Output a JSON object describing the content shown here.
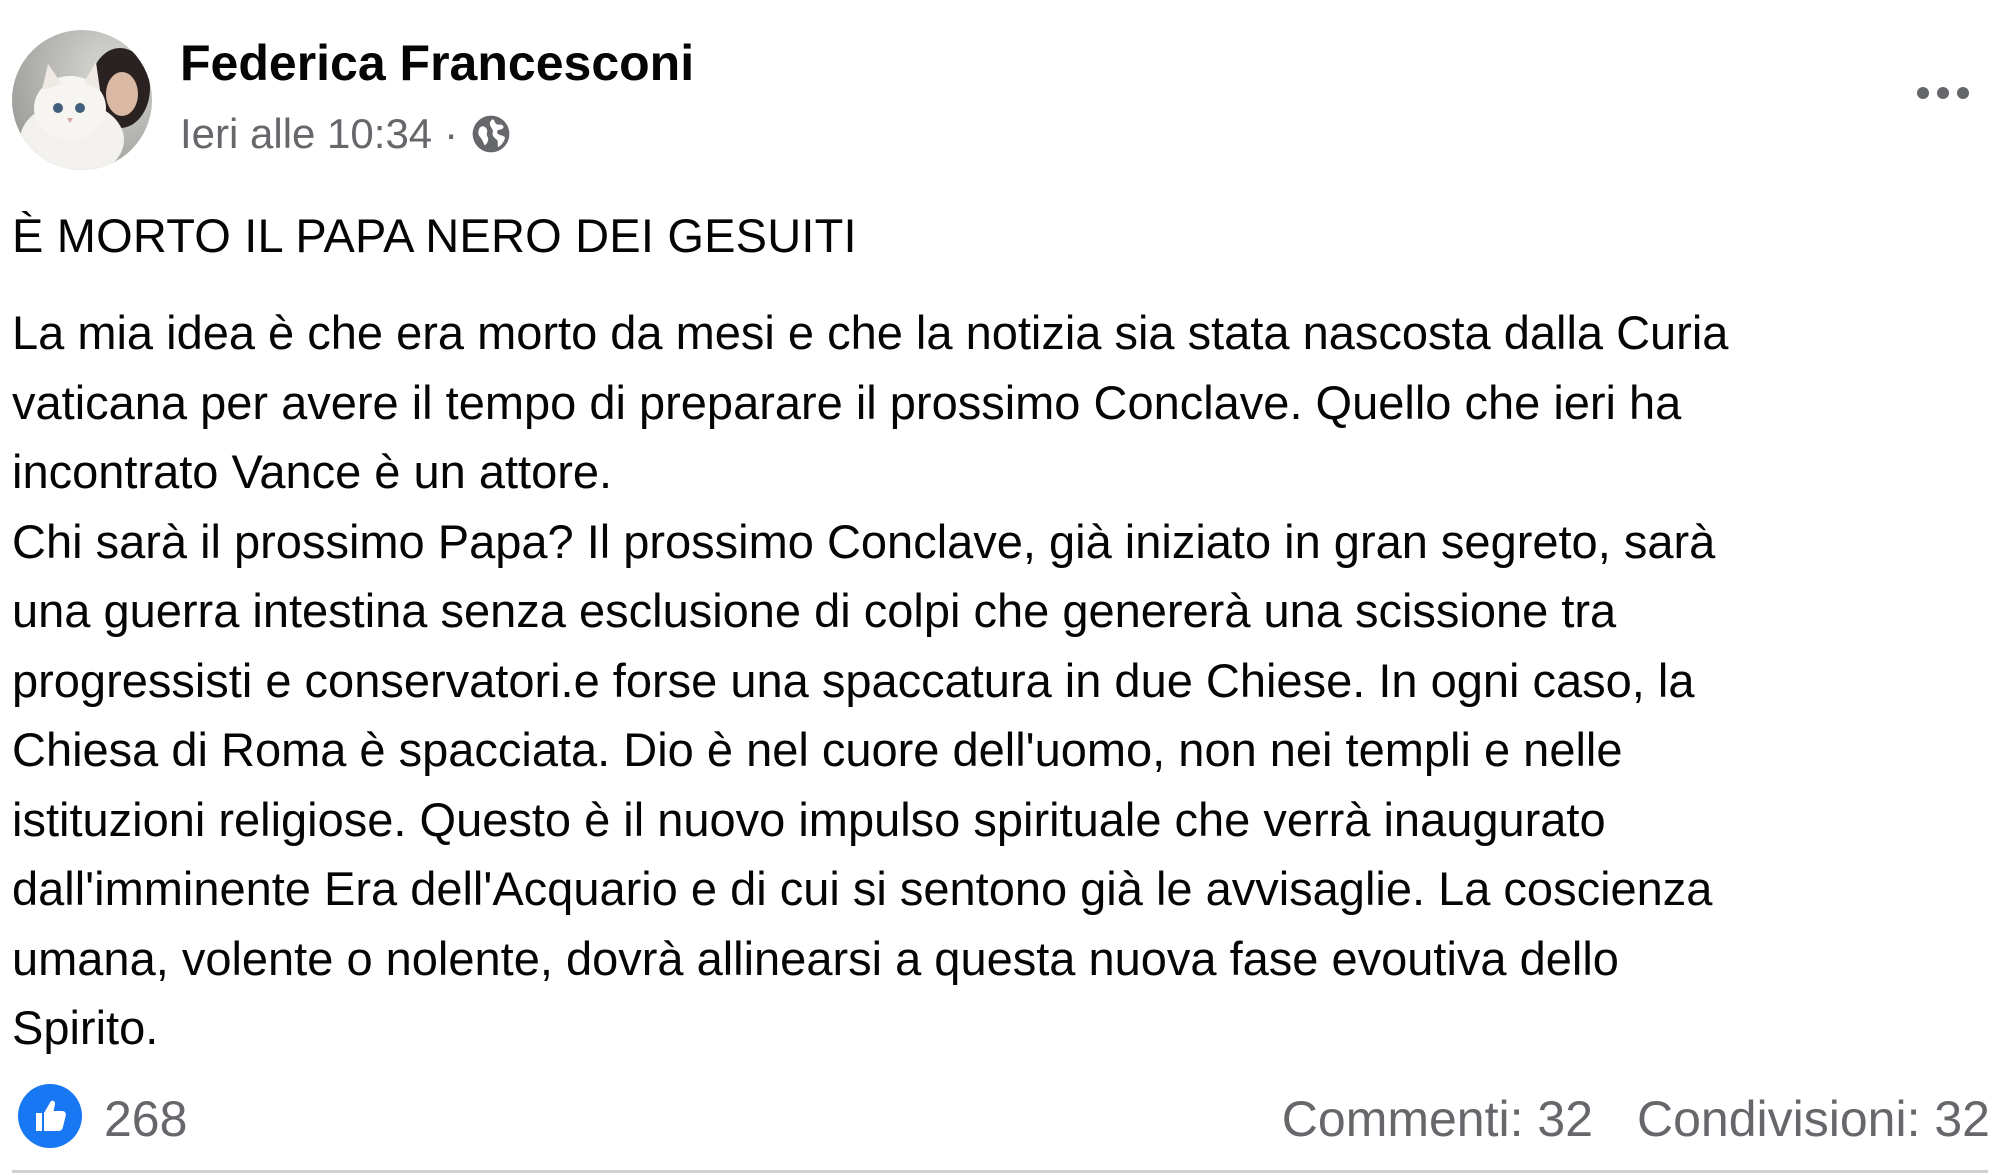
{
  "post": {
    "author": "Federica Francesconi",
    "timestamp": "Ieri alle 10:34",
    "separator": "·",
    "privacy_icon": "globe-icon",
    "more_icon": "more-horizontal-icon",
    "title": "È MORTO IL PAPA NERO DEI GESUITI",
    "body_lines": [
      "La mia idea è che era morto da mesi e che la notizia sia stata nascosta dalla Curia",
      "vaticana per avere il tempo di preparare il prossimo Conclave. Quello che ieri ha",
      "incontrato Vance è un attore.",
      "Chi sarà il prossimo Papa? Il prossimo Conclave, già iniziato in gran segreto, sarà",
      "una guerra intestina senza esclusione di colpi che genererà una scissione tra",
      "progressisti e conservatori.e forse una spaccatura in due Chiese. In ogni caso, la",
      "Chiesa di Roma è spacciata. Dio è nel cuore dell'uomo, non nei templi e nelle",
      "istituzioni religiose. Questo è il nuovo impulso spirituale che verrà inaugurato",
      "dall'imminente Era dell'Acquario e di cui si sentono già le avvisaglie. La coscienza",
      "umana, volente o nolente, dovrà allinearsi a questa nuova fase evoutiva dello",
      "Spirito."
    ]
  },
  "footer": {
    "like_icon": "thumbs-up-icon",
    "like_count": "268",
    "comments": "Commenti: 32",
    "shares": "Condivisioni: 32"
  },
  "colors": {
    "text": "#050505",
    "secondary": "#65676b",
    "like_blue": "#1877f2",
    "divider": "#ced0d4"
  }
}
